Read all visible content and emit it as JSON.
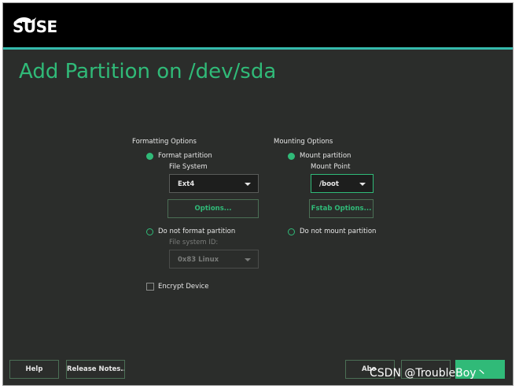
{
  "app": {
    "brand": "SUSE",
    "title": "Add Partition on /dev/sda"
  },
  "formatting": {
    "title": "Formatting Options",
    "format_partition_label": "Format partition",
    "format_partition_selected": true,
    "file_system_label": "File System",
    "file_system_value": "Ext4",
    "options_button": "Options...",
    "no_format_label": "Do not format partition",
    "no_format_selected": false,
    "file_system_id_label": "File system ID:",
    "file_system_id_value": "0x83 Linux",
    "encrypt_label": "Encrypt Device",
    "encrypt_checked": false
  },
  "mounting": {
    "title": "Mounting Options",
    "mount_partition_label": "Mount partition",
    "mount_partition_selected": true,
    "mount_point_label": "Mount Point",
    "mount_point_value": "/boot",
    "fstab_button": "Fstab Options...",
    "no_mount_label": "Do not mount partition",
    "no_mount_selected": false
  },
  "footer": {
    "help_button": "Help",
    "release_notes_button": "Release Notes...",
    "abort_button": "Abo",
    "back_button": "",
    "next_button": ""
  },
  "watermark": "CSDN @TroubleBoy丶",
  "colors": {
    "accent_green": "#30ba78",
    "accent_teal": "#35b9ab",
    "background": "#2b2d2b",
    "topbar": "#000000"
  }
}
